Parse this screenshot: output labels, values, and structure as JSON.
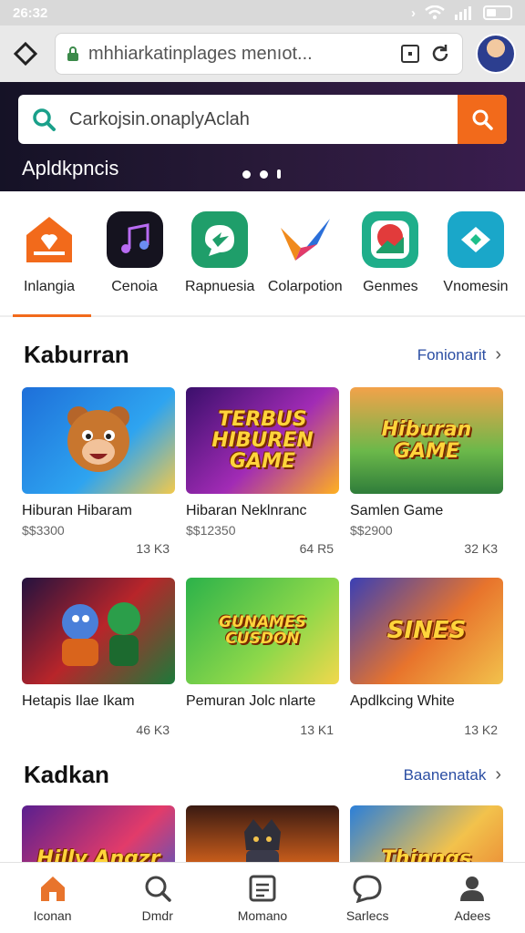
{
  "status": {
    "time": "26:32"
  },
  "browser": {
    "url": "mhhiarkatinplages menıot..."
  },
  "hero": {
    "search_placeholder": "Carkojsin.onaplyAclah",
    "title": "Apldkpncis"
  },
  "categories": [
    {
      "label": "Inlangia",
      "icon": "house-gift-icon",
      "color": "#f26a1b"
    },
    {
      "label": "Cenoia",
      "icon": "music-note-icon",
      "color": "#1a1a2e"
    },
    {
      "label": "Rapnuesia",
      "icon": "bird-chat-icon",
      "color": "#1f9e6a"
    },
    {
      "label": "Colarpotion",
      "icon": "checkmark-logo-icon",
      "color": "#f08a1c"
    },
    {
      "label": "Genmes",
      "icon": "landscape-photo-icon",
      "color": "#e23b3b"
    },
    {
      "label": "Vnomesin",
      "icon": "home-arrow-icon",
      "color": "#1aa7c9"
    }
  ],
  "section1": {
    "title": "Kaburran",
    "link": "Fonionarit",
    "items": [
      {
        "name": "Hiburan Hibaram",
        "price": "$$3300",
        "count": "13 K3",
        "thumb_text": "",
        "bg": "linear-gradient(135deg,#1e6fd9,#2ea4f0 60%,#f2c94c)"
      },
      {
        "name": "Hibaran Neklnranc",
        "price": "$$12350",
        "count": "64 R5",
        "thumb_text": "TERBUS HIBUREN GAME",
        "bg": "linear-gradient(135deg,#3a0f6b,#a12bb5 55%,#ffb020)"
      },
      {
        "name": "Samlen Game",
        "price": "$$2900",
        "count": "32 K3",
        "thumb_text": "Hiburan GAME",
        "bg": "linear-gradient(180deg,#f3a24a,#6bb84a 60%,#2f7d3a)"
      },
      {
        "name": "Hetapis Ilae Ikam",
        "price": "",
        "count": "46 K3",
        "thumb_text": "",
        "bg": "linear-gradient(135deg,#23123f,#b8252a 50%,#1c7a3a)"
      },
      {
        "name": "Pemuran Jolc nlarte",
        "price": "",
        "count": "13 K1",
        "thumb_text": "GUNAMES CUSDON",
        "bg": "linear-gradient(135deg,#2bb24a,#8ed84a 60%,#f2d84c)"
      },
      {
        "name": "Apdlkcing White",
        "price": "",
        "count": "13 K2",
        "thumb_text": "SINES",
        "bg": "linear-gradient(135deg,#3a3fb5,#e8742c 55%,#f2c24c)"
      }
    ]
  },
  "section2": {
    "title": "Kadkan",
    "link": "Baanenatak",
    "items": [
      {
        "thumb_text": "Hilly Angzr",
        "bg": "linear-gradient(135deg,#5a1f8f,#e23b6a 55%,#2b5fd9)"
      },
      {
        "thumb_text": "",
        "bg": "linear-gradient(180deg,#3a1a12,#d9641c 60%,#f2a23c)"
      },
      {
        "thumb_text": "Thinngs",
        "bg": "linear-gradient(135deg,#2b7fd9,#f2c24c 55%,#e8742c)"
      }
    ]
  },
  "nav": [
    {
      "label": "Iconan",
      "icon": "home-icon",
      "active": true
    },
    {
      "label": "Dmdr",
      "icon": "search-icon"
    },
    {
      "label": "Momano",
      "icon": "document-icon"
    },
    {
      "label": "Sarlecs",
      "icon": "chat-bubble-icon"
    },
    {
      "label": "Adees",
      "icon": "user-icon"
    }
  ],
  "colors": {
    "accent": "#f26a1b",
    "link": "#2b4ea3"
  }
}
